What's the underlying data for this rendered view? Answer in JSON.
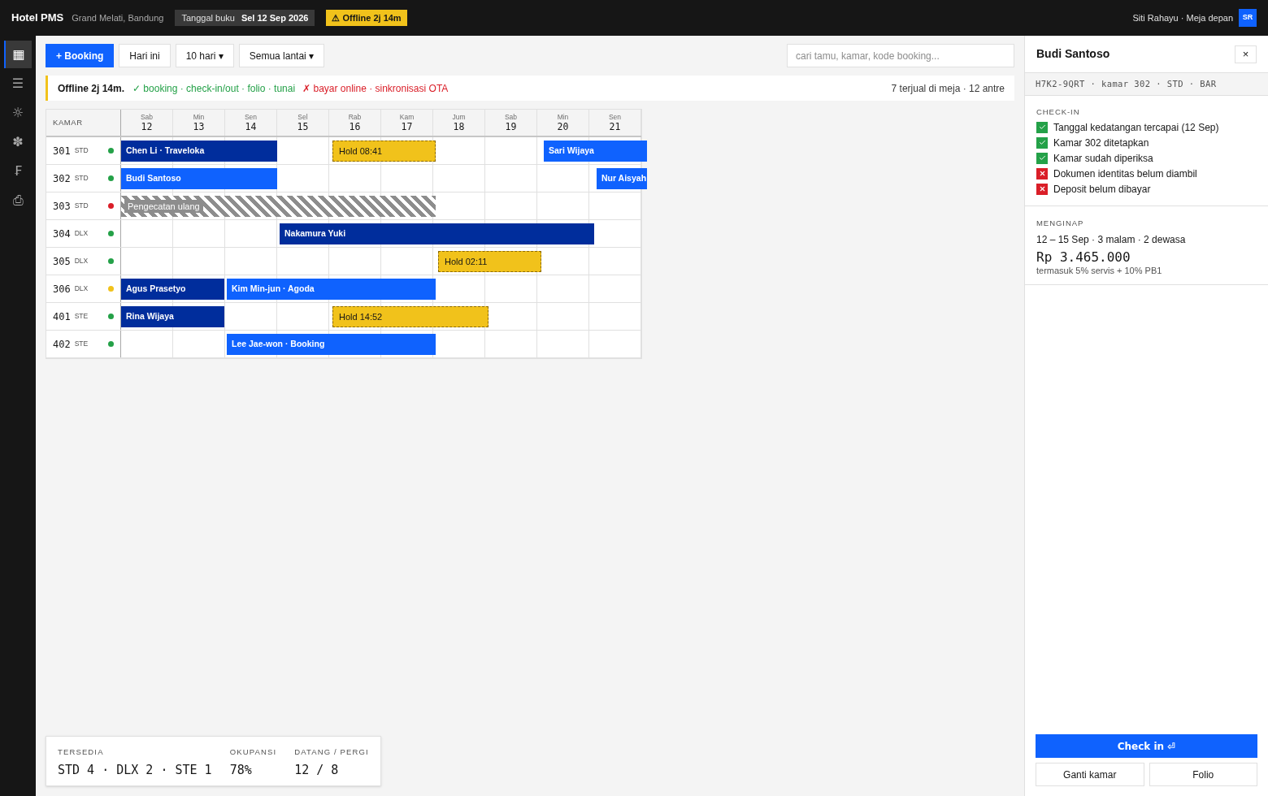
{
  "topbar": {
    "app_name": "Hotel PMS",
    "property": "Grand Melati, Bandung",
    "business_date": {
      "label": "Tanggal buku",
      "value": "Sel 12 Sep 2026"
    },
    "offline_badge": "⚠ Offline 2j 14m",
    "user": "Siti Rahayu · Meja depan",
    "avatar": "SR"
  },
  "sidebar": {
    "items": [
      {
        "icon": "▦",
        "selected": true
      },
      {
        "icon": "☰",
        "selected": false
      },
      {
        "icon": "☼",
        "selected": false
      },
      {
        "icon": "✽",
        "selected": false
      },
      {
        "icon": "₣",
        "selected": false
      },
      {
        "icon": "⎙",
        "selected": false
      }
    ]
  },
  "toolbar": {
    "buttons": [
      {
        "label": "+ Booking",
        "kind": "primary"
      },
      {
        "label": "Hari ini",
        "kind": "secondary"
      },
      {
        "label": "10 hari ▾",
        "kind": "secondary"
      },
      {
        "label": "Semua lantai ▾",
        "kind": "secondary"
      }
    ],
    "search": {
      "placeholder": "cari tamu, kamar, kode booking..."
    }
  },
  "banner": {
    "title": "Offline 2j 14m.",
    "available": "✓ booking · check-in/out · folio · tunai",
    "unavailable": "✗ bayar online · sinkronisasi OTA",
    "queue": "7 terjual di meja · 12 antre"
  },
  "calendar": {
    "room_header": "KAMAR",
    "days": [
      {
        "weekday": "Sab",
        "date": "12"
      },
      {
        "weekday": "Min",
        "date": "13"
      },
      {
        "weekday": "Sen",
        "date": "14"
      },
      {
        "weekday": "Sel",
        "date": "15"
      },
      {
        "weekday": "Rab",
        "date": "16"
      },
      {
        "weekday": "Kam",
        "date": "17"
      },
      {
        "weekday": "Jum",
        "date": "18"
      },
      {
        "weekday": "Sab",
        "date": "19"
      },
      {
        "weekday": "Min",
        "date": "20"
      },
      {
        "weekday": "Sen",
        "date": "21"
      }
    ],
    "rows": [
      {
        "room": "301",
        "type": "STD",
        "color": "#24a148",
        "cells": [
          {
            "kind": "booking",
            "label": "Chen Li · Traveloka",
            "color": "#002d9c"
          },
          {
            "kind": "continued"
          },
          {
            "kind": "continued"
          },
          {
            "kind": "empty"
          },
          {
            "kind": "hold",
            "label": "Hold 08:41"
          },
          {
            "kind": "continued"
          },
          {
            "kind": "empty"
          },
          {
            "kind": "empty"
          },
          {
            "kind": "booking",
            "label": "Sari Wijaya",
            "color": "#0f62fe"
          },
          {
            "kind": "continued"
          }
        ]
      },
      {
        "room": "302",
        "type": "STD",
        "color": "#24a148",
        "cells": [
          {
            "kind": "booking",
            "label": "Budi Santoso",
            "color": "#0f62fe"
          },
          {
            "kind": "continued"
          },
          {
            "kind": "continued"
          },
          {
            "kind": "empty"
          },
          {
            "kind": "empty"
          },
          {
            "kind": "empty"
          },
          {
            "kind": "empty"
          },
          {
            "kind": "empty"
          },
          {
            "kind": "empty"
          },
          {
            "kind": "booking",
            "label": "Nur Aisyah",
            "color": "#0f62fe"
          }
        ]
      },
      {
        "room": "303",
        "type": "STD",
        "color": "#da1e28",
        "cells": [
          {
            "kind": "blocked",
            "label": "Pengecatan ulang"
          },
          {
            "kind": "continued"
          },
          {
            "kind": "continued"
          },
          {
            "kind": "continued"
          },
          {
            "kind": "continued"
          },
          {
            "kind": "continued"
          },
          {
            "kind": "empty"
          },
          {
            "kind": "empty"
          },
          {
            "kind": "empty"
          },
          {
            "kind": "empty"
          }
        ]
      },
      {
        "room": "304",
        "type": "DLX",
        "color": "#24a148",
        "cells": [
          {
            "kind": "empty"
          },
          {
            "kind": "empty"
          },
          {
            "kind": "empty"
          },
          {
            "kind": "booking",
            "label": "Nakamura Yuki",
            "color": "#002d9c"
          },
          {
            "kind": "continued"
          },
          {
            "kind": "continued"
          },
          {
            "kind": "continued"
          },
          {
            "kind": "continued"
          },
          {
            "kind": "continued"
          },
          {
            "kind": "empty"
          }
        ]
      },
      {
        "room": "305",
        "type": "DLX",
        "color": "#24a148",
        "cells": [
          {
            "kind": "empty"
          },
          {
            "kind": "empty"
          },
          {
            "kind": "empty"
          },
          {
            "kind": "empty"
          },
          {
            "kind": "empty"
          },
          {
            "kind": "empty"
          },
          {
            "kind": "hold",
            "label": "Hold 02:11"
          },
          {
            "kind": "continued"
          },
          {
            "kind": "empty"
          },
          {
            "kind": "empty"
          }
        ]
      },
      {
        "room": "306",
        "type": "DLX",
        "color": "#f1c21b",
        "cells": [
          {
            "kind": "booking",
            "label": "Agus Prasetyo",
            "color": "#002d9c"
          },
          {
            "kind": "continued"
          },
          {
            "kind": "booking",
            "label": "Kim Min-jun · Agoda",
            "color": "#0f62fe"
          },
          {
            "kind": "continued"
          },
          {
            "kind": "continued"
          },
          {
            "kind": "continued"
          },
          {
            "kind": "empty"
          },
          {
            "kind": "empty"
          },
          {
            "kind": "empty"
          },
          {
            "kind": "empty"
          }
        ]
      },
      {
        "room": "401",
        "type": "STE",
        "color": "#24a148",
        "cells": [
          {
            "kind": "booking",
            "label": "Rina Wijaya",
            "color": "#002d9c"
          },
          {
            "kind": "continued"
          },
          {
            "kind": "empty"
          },
          {
            "kind": "empty"
          },
          {
            "kind": "hold",
            "label": "Hold 14:52"
          },
          {
            "kind": "continued"
          },
          {
            "kind": "continued"
          },
          {
            "kind": "empty"
          },
          {
            "kind": "empty"
          },
          {
            "kind": "empty"
          }
        ]
      },
      {
        "room": "402",
        "type": "STE",
        "color": "#24a148",
        "cells": [
          {
            "kind": "empty"
          },
          {
            "kind": "empty"
          },
          {
            "kind": "booking",
            "label": "Lee Jae-won · Booking",
            "color": "#0f62fe"
          },
          {
            "kind": "continued"
          },
          {
            "kind": "continued"
          },
          {
            "kind": "continued"
          },
          {
            "kind": "empty"
          },
          {
            "kind": "empty"
          },
          {
            "kind": "empty"
          },
          {
            "kind": "empty"
          }
        ]
      }
    ]
  },
  "stats": [
    {
      "label": "TERSEDIA",
      "value": "STD 4 · DLX 2 · STE 1"
    },
    {
      "label": "OKUPANSI",
      "value": "78%"
    },
    {
      "label": "DATANG / PERGI",
      "value": "12 / 8"
    }
  ],
  "panel": {
    "guest": "Budi Santoso",
    "close": "×",
    "reference": "H7K2-9QRT · kamar 302 · STD · BAR",
    "checkin": {
      "title": "CHECK-IN",
      "items": [
        {
          "label": "Tanggal kedatangan tercapai (12 Sep)",
          "passed": true
        },
        {
          "label": "Kamar 302 ditetapkan",
          "passed": true
        },
        {
          "label": "Kamar sudah diperiksa",
          "passed": true
        },
        {
          "label": "Dokumen identitas belum diambil",
          "passed": false
        },
        {
          "label": "Deposit belum dibayar",
          "passed": false
        }
      ]
    },
    "stay": {
      "title": "MENGINAP",
      "summary": "12 – 15 Sep · 3 malam · 2 dewasa",
      "total": "Rp 3.465.000",
      "note": "termasuk 5% servis + 10% PB1"
    },
    "actions": [
      {
        "label": "Check in ⏎",
        "kind": "primary"
      },
      {
        "label": "Ganti kamar",
        "kind": "secondary"
      },
      {
        "label": "Folio",
        "kind": "secondary"
      }
    ]
  }
}
